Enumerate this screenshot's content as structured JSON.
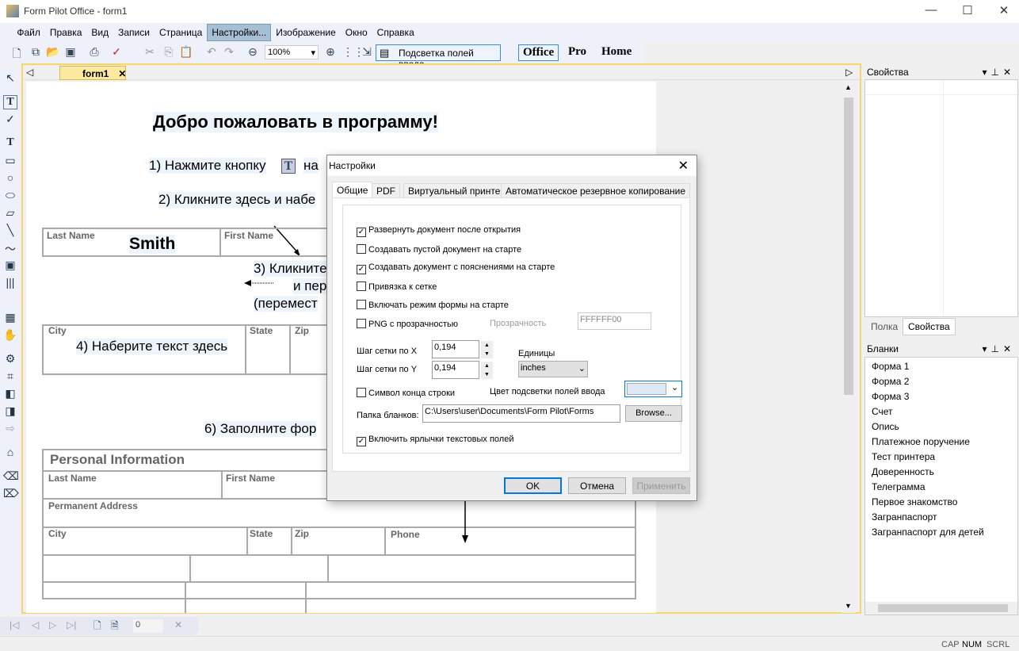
{
  "window": {
    "title": "Form Pilot Office - form1"
  },
  "menu": [
    "Файл",
    "Правка",
    "Вид",
    "Записи",
    "Страница",
    "Настройки...",
    "Изображение",
    "Окно",
    "Справка"
  ],
  "toolbar": {
    "zoom": "100%",
    "highlight_label": "Подсветка полей ввода",
    "modes": [
      "Office",
      "Pro",
      "Home"
    ]
  },
  "doc_tab": "form1",
  "document": {
    "heading": "Добро пожаловать в программу!",
    "step1": "1) Нажмите кнопку",
    "step1b": "на",
    "step2": "2) Кликните здесь и набе",
    "step3a": "3) Кликните",
    "step3b": "и пер",
    "step3c": "(перемест",
    "step4": "4) Наберите текст здесь",
    "step6": "6) Заполните фор",
    "labels": {
      "last_name": "Last Name",
      "first_name": "First Name",
      "city": "City",
      "state": "State",
      "zip": "Zip",
      "phone": "Phone",
      "permanent_address": "Permanent Address",
      "personal_info": "Personal Information"
    },
    "smith": "Smith"
  },
  "properties_panel": {
    "title": "Свойства",
    "tabs": [
      "Полка",
      "Свойства"
    ]
  },
  "forms_panel": {
    "title": "Бланки",
    "items": [
      "Форма 1",
      "Форма 2",
      "Форма 3",
      "Счет",
      "Опись",
      "Платежное поручение",
      "Тест принтера",
      "Доверенность",
      "Телеграмма",
      "Первое знакомство",
      "Загранпаспорт",
      "Загранпаспорт для детей"
    ]
  },
  "navbar": {
    "page": "0"
  },
  "status": [
    "CAP",
    "NUM",
    "SCRL"
  ],
  "dialog": {
    "title": "Настройки",
    "tabs": [
      "Общие",
      "PDF",
      "Виртуальный принтер",
      "Автоматическое резервное копирование"
    ],
    "checkboxes": [
      {
        "label": "Развернуть документ после открытия",
        "checked": true
      },
      {
        "label": "Создавать пустой документ на старте",
        "checked": false
      },
      {
        "label": "Создавать документ с пояснениями на старте",
        "checked": true
      },
      {
        "label": "Привязка к сетке",
        "checked": false
      },
      {
        "label": "Включать режим формы на старте",
        "checked": false
      },
      {
        "label": "PNG с прозрачностью",
        "checked": false
      },
      {
        "label": "Символ конца строки",
        "checked": false
      },
      {
        "label": "Включить ярлычки текстовых полей",
        "checked": true
      }
    ],
    "transparency_label": "Прозрачность",
    "transparency_value": "FFFFFF00",
    "grid_x_label": "Шаг сетки по X",
    "grid_x": "0,194",
    "grid_y_label": "Шаг сетки по Y",
    "grid_y": "0,194",
    "units_label": "Единицы",
    "units": "inches",
    "highlight_color_label": "Цвет подсветки полей ввода",
    "highlight_color": "#dde9f7",
    "folder_label": "Папка бланков:",
    "folder": "C:\\Users\\user\\Documents\\Form Pilot\\Forms",
    "browse": "Browse...",
    "ok": "OK",
    "cancel": "Отмена",
    "apply": "Применить"
  }
}
